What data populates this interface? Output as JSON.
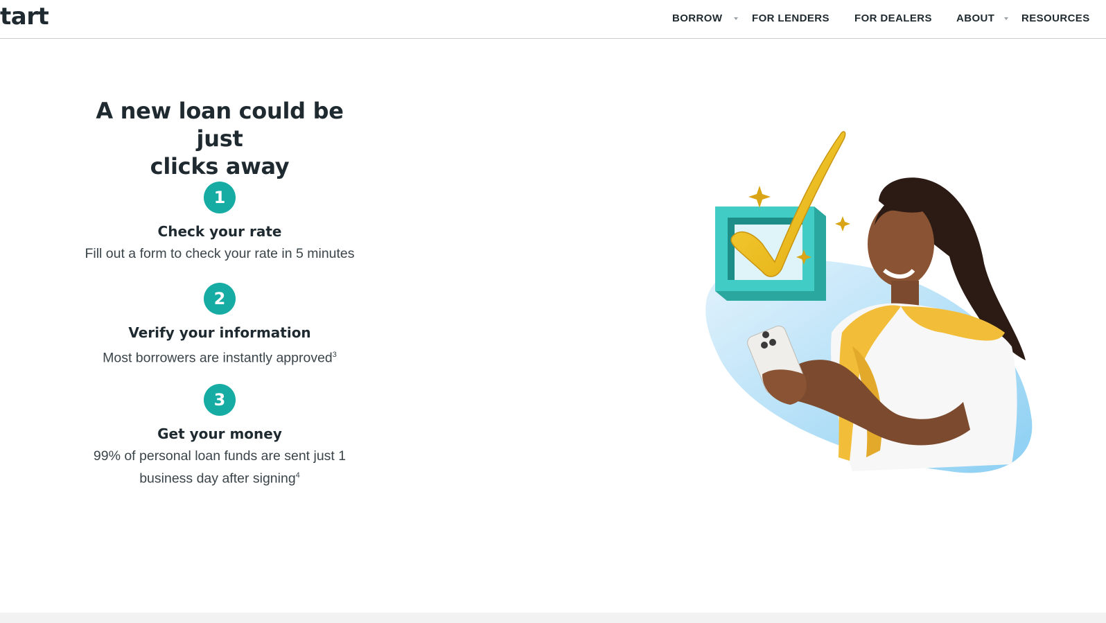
{
  "header": {
    "logo_text": "tart",
    "nav": [
      {
        "label": "BORROW",
        "has_dropdown": true
      },
      {
        "label": "FOR LENDERS",
        "has_dropdown": false
      },
      {
        "label": "FOR DEALERS",
        "has_dropdown": false
      },
      {
        "label": "ABOUT",
        "has_dropdown": true
      },
      {
        "label": "RESOURCES",
        "has_dropdown": false
      }
    ]
  },
  "main": {
    "headline_line1": "A new loan could be just",
    "headline_line2": "clicks away",
    "steps": [
      {
        "number": "1",
        "title": "Check your rate",
        "description": "Fill out a form to check your rate in 5 minutes"
      },
      {
        "number": "2",
        "title": "Verify your information",
        "description": "Most borrowers are instantly approved",
        "footnote": "3"
      },
      {
        "number": "3",
        "title": "Get your money",
        "description_line1": "99% of personal loan funds are sent just 1",
        "description_line2": "business day after signing",
        "footnote": "4"
      }
    ]
  },
  "colors": {
    "accent_teal": "#16aca3",
    "checkmark_yellow": "#f2c31b",
    "box_teal": "#3fcbc4",
    "blob_blue": "#a9dcf7",
    "text_dark": "#1f2a30"
  },
  "icons": [
    "chevron-down-icon",
    "checkbox-check-icon",
    "sparkle-icon"
  ]
}
